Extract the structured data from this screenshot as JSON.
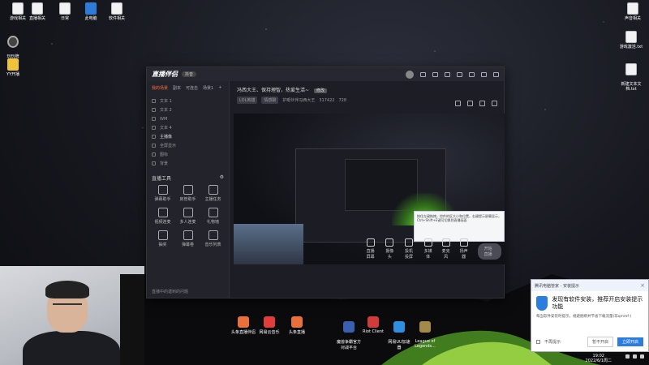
{
  "desktop": {
    "left_icons": [
      {
        "label": "游戏相关",
        "icon": "file-icon"
      },
      {
        "label": "直播相关",
        "icon": "file-icon"
      },
      {
        "label": "日常",
        "icon": "file-icon"
      },
      {
        "label": "此电脑",
        "icon": "computer-icon"
      },
      {
        "label": "软件相关",
        "icon": "file-icon"
      }
    ],
    "col_icons": [
      {
        "label": "玩玩牌\nDemo",
        "icon": "gear-icon"
      },
      {
        "label": "YY开播",
        "icon": "yy-icon"
      }
    ],
    "right_icons": [
      {
        "label": "声音相关",
        "icon": "file-icon"
      },
      {
        "label": "游戏激活.txt",
        "icon": "text-file-icon"
      },
      {
        "label": "新建文本文\n档.txt",
        "icon": "text-file-icon"
      }
    ],
    "taskbar_apps": [
      {
        "label": "头条直播伴侣"
      },
      {
        "label": "网易云音乐"
      },
      {
        "label": "头条直播"
      },
      {
        "label": "魔兽争霸官方\n对战平台"
      },
      {
        "label": "Riot Client"
      },
      {
        "label": "网易UU加速\n器"
      },
      {
        "label": "League of\nLegends..."
      }
    ]
  },
  "app": {
    "logo": "直播伴侣",
    "version": "抖音",
    "side_tabs": [
      "我的场景",
      "副本",
      "可连击",
      "场景1",
      "+"
    ],
    "scenes": [
      "文本 1",
      "文本 2",
      "WM",
      "文本 4",
      "主播像",
      "全屏显示",
      "图标",
      "背景"
    ],
    "tools_title": "直播工具",
    "tools": [
      {
        "label": "弹幕助手"
      },
      {
        "label": "房管助手"
      },
      {
        "label": "主播任务"
      },
      {
        "label": "视频连麦"
      },
      {
        "label": "多人连麦"
      },
      {
        "label": "礼物墙"
      },
      {
        "label": "抽奖"
      },
      {
        "label": "弹幕卷"
      },
      {
        "label": "音乐列表"
      }
    ],
    "side_footer": "直播中的遇到的问题",
    "room_title": "冯西大王、保持理智，热爱生活~",
    "room_tag": "修改",
    "room_meta": {
      "category": "LOL英雄",
      "status": "情感聊",
      "owner": "护眼伙伴冯西大王",
      "viewers": "317422",
      "likes": "728"
    },
    "bottom_controls": [
      {
        "label": "直播屏幕"
      },
      {
        "label": "摄像头"
      },
      {
        "label": "投机投屏"
      },
      {
        "label": "多媒体"
      },
      {
        "label": "麦克风"
      },
      {
        "label": "扬声器"
      }
    ],
    "start_live": "开始直播"
  },
  "popup": {
    "header": "腾讯电脑管家 - 安装提示",
    "title": "发现有软件安装，推荐开启安装提示功能",
    "desc": "每当软件安装时提示，规避捆绑并节省下载流量(非qmmf-)",
    "checkbox": "不再提示",
    "later": "暂不开启",
    "ok": "立即开启"
  },
  "mini_notice": "按住左键拖拽，控件的区大小和位置，右键提示屏幕显示，Ctrl+Shift+E键可切换到直播画面",
  "clock": {
    "time": "19:02",
    "date": "2022/6/1周二"
  }
}
